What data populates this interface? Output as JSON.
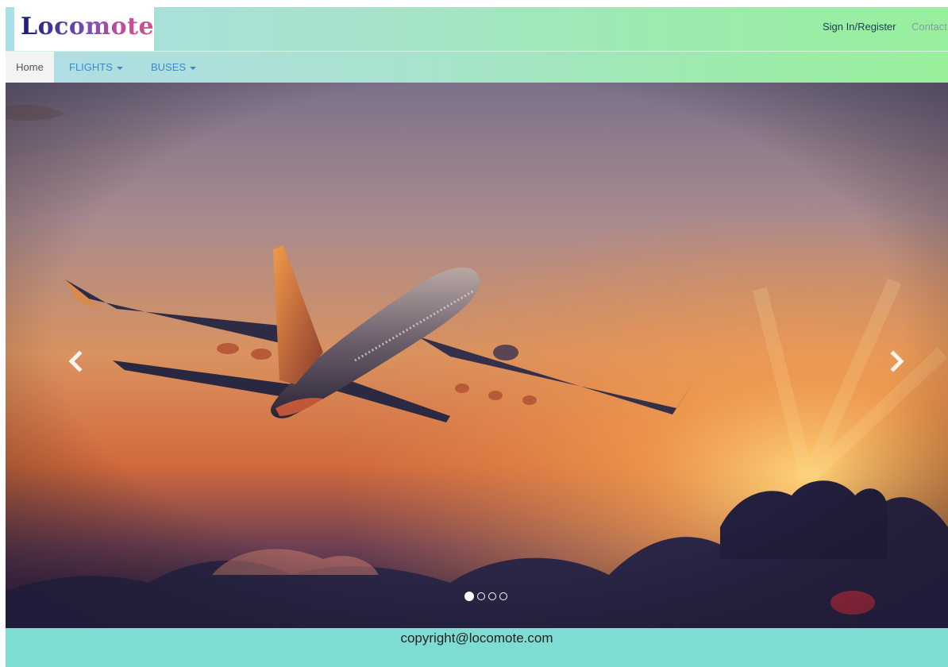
{
  "header": {
    "logo_text": "Locomote",
    "links": {
      "signin": "Sign In/Register",
      "contact": "Contact"
    }
  },
  "nav": {
    "home": "Home",
    "flights": "FLIGHTS",
    "buses": "BUSES"
  },
  "carousel": {
    "image_subject": "airplane-at-sunset",
    "slide_count": 4,
    "active_slide": 1
  },
  "footer": {
    "text": "copyright@locomote.com"
  },
  "colors": {
    "link_blue": "#3a8bc3",
    "footer_bg": "#7edcd3",
    "header_green": "#97f09d",
    "header_teal": "#a9dfe6"
  }
}
